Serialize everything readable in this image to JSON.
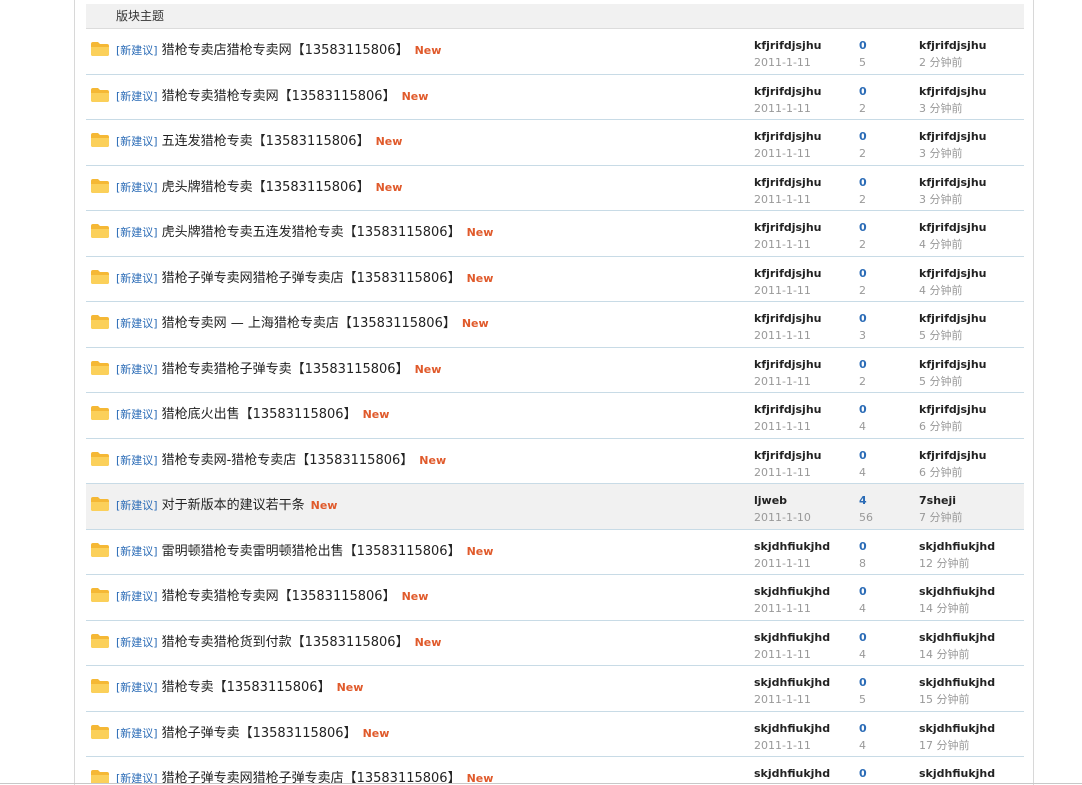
{
  "header": {
    "col_subject": "版块主题"
  },
  "rows": [
    {
      "tag": "[新建议]",
      "title": "猎枪专卖店猎枪专卖网【13583115806】",
      "new": "New",
      "author": "kfjrifdjsjhu",
      "date": "2011-1-11",
      "replies": "0",
      "views": "5",
      "last_user": "kfjrifdjsjhu",
      "last_time": "2 分钟前"
    },
    {
      "tag": "[新建议]",
      "title": "猎枪专卖猎枪专卖网【13583115806】",
      "new": "New",
      "author": "kfjrifdjsjhu",
      "date": "2011-1-11",
      "replies": "0",
      "views": "2",
      "last_user": "kfjrifdjsjhu",
      "last_time": "3 分钟前"
    },
    {
      "tag": "[新建议]",
      "title": "五连发猎枪专卖【13583115806】",
      "new": "New",
      "author": "kfjrifdjsjhu",
      "date": "2011-1-11",
      "replies": "0",
      "views": "2",
      "last_user": "kfjrifdjsjhu",
      "last_time": "3 分钟前"
    },
    {
      "tag": "[新建议]",
      "title": "虎头牌猎枪专卖【13583115806】",
      "new": "New",
      "author": "kfjrifdjsjhu",
      "date": "2011-1-11",
      "replies": "0",
      "views": "2",
      "last_user": "kfjrifdjsjhu",
      "last_time": "3 分钟前"
    },
    {
      "tag": "[新建议]",
      "title": "虎头牌猎枪专卖五连发猎枪专卖【13583115806】",
      "new": "New",
      "author": "kfjrifdjsjhu",
      "date": "2011-1-11",
      "replies": "0",
      "views": "2",
      "last_user": "kfjrifdjsjhu",
      "last_time": "4 分钟前"
    },
    {
      "tag": "[新建议]",
      "title": "猎枪子弹专卖网猎枪子弹专卖店【13583115806】",
      "new": "New",
      "author": "kfjrifdjsjhu",
      "date": "2011-1-11",
      "replies": "0",
      "views": "2",
      "last_user": "kfjrifdjsjhu",
      "last_time": "4 分钟前"
    },
    {
      "tag": "[新建议]",
      "title": "猎枪专卖网 — 上海猎枪专卖店【13583115806】",
      "new": "New",
      "author": "kfjrifdjsjhu",
      "date": "2011-1-11",
      "replies": "0",
      "views": "3",
      "last_user": "kfjrifdjsjhu",
      "last_time": "5 分钟前"
    },
    {
      "tag": "[新建议]",
      "title": "猎枪专卖猎枪子弹专卖【13583115806】",
      "new": "New",
      "author": "kfjrifdjsjhu",
      "date": "2011-1-11",
      "replies": "0",
      "views": "2",
      "last_user": "kfjrifdjsjhu",
      "last_time": "5 分钟前"
    },
    {
      "tag": "[新建议]",
      "title": "猎枪底火出售【13583115806】",
      "new": "New",
      "author": "kfjrifdjsjhu",
      "date": "2011-1-11",
      "replies": "0",
      "views": "4",
      "last_user": "kfjrifdjsjhu",
      "last_time": "6 分钟前"
    },
    {
      "tag": "[新建议]",
      "title": "猎枪专卖网-猎枪专卖店【13583115806】",
      "new": "New",
      "author": "kfjrifdjsjhu",
      "date": "2011-1-11",
      "replies": "0",
      "views": "4",
      "last_user": "kfjrifdjsjhu",
      "last_time": "6 分钟前"
    },
    {
      "tag": "[新建议]",
      "title": "对于新版本的建议若干条",
      "new": "New",
      "author": "ljweb",
      "date": "2011-1-10",
      "replies": "4",
      "views": "56",
      "last_user": "7sheji",
      "last_time": "7 分钟前",
      "highlight": true
    },
    {
      "tag": "[新建议]",
      "title": "雷明顿猎枪专卖雷明顿猎枪出售【13583115806】",
      "new": "New",
      "author": "skjdhfiukjhd",
      "date": "2011-1-11",
      "replies": "0",
      "views": "8",
      "last_user": "skjdhfiukjhd",
      "last_time": "12 分钟前"
    },
    {
      "tag": "[新建议]",
      "title": "猎枪专卖猎枪专卖网【13583115806】",
      "new": "New",
      "author": "skjdhfiukjhd",
      "date": "2011-1-11",
      "replies": "0",
      "views": "4",
      "last_user": "skjdhfiukjhd",
      "last_time": "14 分钟前"
    },
    {
      "tag": "[新建议]",
      "title": "猎枪专卖猎枪货到付款【13583115806】",
      "new": "New",
      "author": "skjdhfiukjhd",
      "date": "2011-1-11",
      "replies": "0",
      "views": "4",
      "last_user": "skjdhfiukjhd",
      "last_time": "14 分钟前"
    },
    {
      "tag": "[新建议]",
      "title": "猎枪专卖【13583115806】",
      "new": "New",
      "author": "skjdhfiukjhd",
      "date": "2011-1-11",
      "replies": "0",
      "views": "5",
      "last_user": "skjdhfiukjhd",
      "last_time": "15 分钟前"
    },
    {
      "tag": "[新建议]",
      "title": "猎枪子弹专卖【13583115806】",
      "new": "New",
      "author": "skjdhfiukjhd",
      "date": "2011-1-11",
      "replies": "0",
      "views": "4",
      "last_user": "skjdhfiukjhd",
      "last_time": "17 分钟前"
    },
    {
      "tag": "[新建议]",
      "title": "猎枪子弹专卖网猎枪子弹专卖店【13583115806】",
      "new": "New",
      "author": "skjdhfiukjhd",
      "date": "",
      "replies": "0",
      "views": "",
      "last_user": "skjdhfiukjhd",
      "last_time": ""
    }
  ]
}
